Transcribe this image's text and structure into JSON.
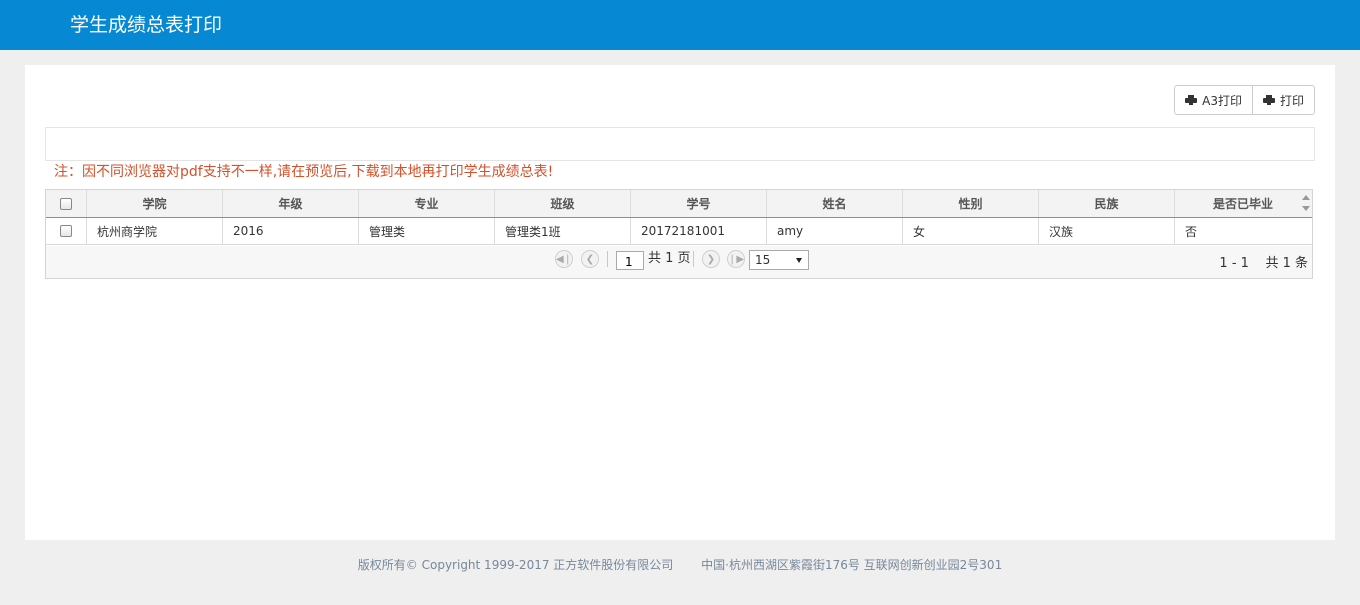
{
  "header": {
    "title": "学生成绩总表打印"
  },
  "toolbar": {
    "a3_print_label": "A3打印",
    "print_label": "打印"
  },
  "notice": "注：因不同浏览器对pdf支持不一样,请在预览后,下载到本地再打印学生成绩总表!",
  "table": {
    "columns": [
      "学院",
      "年级",
      "专业",
      "班级",
      "学号",
      "姓名",
      "性别",
      "民族",
      "是否已毕业"
    ],
    "rows": [
      [
        "杭州商学院",
        "2016",
        "管理类",
        "管理类1班",
        "20172181001",
        "amy",
        "女",
        "汉族",
        "否"
      ]
    ]
  },
  "pager": {
    "current_page": "1",
    "total_pages_text": "共 1 页",
    "page_size": "15",
    "range_text": "1 - 1",
    "total_text": "共 1 条"
  },
  "footer": {
    "copyright": "版权所有© Copyright 1999-2017 正方软件股份有限公司",
    "address": "中国·杭州西湖区紫霞街176号 互联网创新创业园2号301"
  }
}
